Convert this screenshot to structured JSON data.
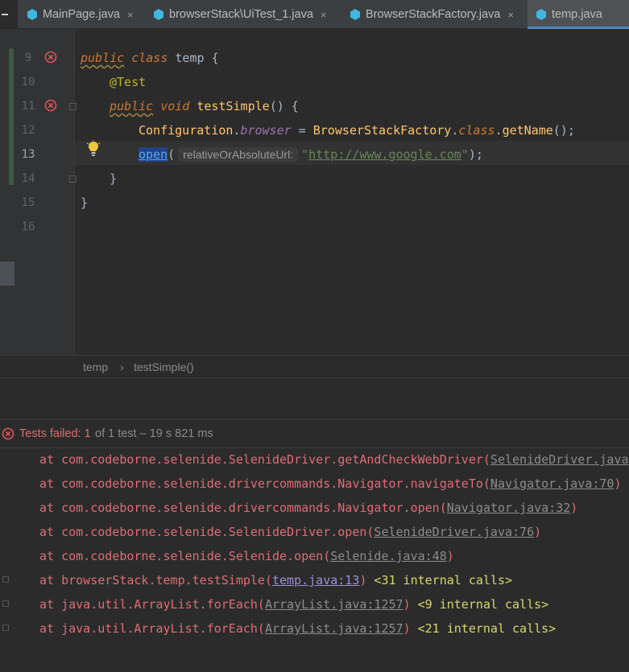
{
  "tabs": [
    {
      "label": "MainPage.java",
      "active": false
    },
    {
      "label": "browserStack\\UiTest_1.java",
      "active": false
    },
    {
      "label": "BrowserStackFactory.java",
      "active": false
    },
    {
      "label": "temp.java",
      "active": true
    }
  ],
  "tab_close": "×",
  "editor": {
    "line_numbers": [
      "9",
      "10",
      "11",
      "12",
      "13",
      "14",
      "15",
      "16"
    ],
    "line9": {
      "kw1": "public",
      "kw2": "class",
      "name": "temp",
      "brace": "{"
    },
    "line10": {
      "annotation": "@Test"
    },
    "line11": {
      "kw1": "public",
      "kw2": "void",
      "method": "testSimple",
      "rest": "() {"
    },
    "line12": {
      "cls": "Configuration",
      "dot": ".",
      "field": "browser",
      "eq": " = ",
      "factory": "BrowserStackFactory",
      "dot2": ".",
      "kwclass": "class",
      "dot3": ".",
      "getname": "getName",
      "end": "();"
    },
    "line13": {
      "call": "open",
      "paren": "(",
      "hint": "relativeOrAbsoluteUrl:",
      "q1": "\"",
      "url": "http://www.google.com",
      "q2": "\"",
      "end": ");"
    },
    "line14": {
      "brace": "}"
    },
    "line15": {
      "brace": "}"
    }
  },
  "breadcrumb": {
    "item1": "temp",
    "sep": "›",
    "item2": "testSimple()"
  },
  "status": {
    "failed_label": "Tests failed:",
    "failed_count": "1",
    "rest": "of 1 test – 19 s 821 ms"
  },
  "trace": [
    {
      "prefix": "at com.codeborne.selenide.SelenideDriver.getAndCheckWebDriver(",
      "link": "SelenideDriver.java",
      "suffix": "",
      "internal": ""
    },
    {
      "prefix": "at com.codeborne.selenide.drivercommands.Navigator.navigateTo(",
      "link": "Navigator.java:70",
      "suffix": ")",
      "internal": ""
    },
    {
      "prefix": "at com.codeborne.selenide.drivercommands.Navigator.open(",
      "link": "Navigator.java:32",
      "suffix": ")",
      "internal": ""
    },
    {
      "prefix": "at com.codeborne.selenide.SelenideDriver.open(",
      "link": "SelenideDriver.java:76",
      "suffix": ")",
      "internal": ""
    },
    {
      "prefix": "at com.codeborne.selenide.Selenide.open(",
      "link": "Selenide.java:48",
      "suffix": ")",
      "internal": ""
    },
    {
      "prefix": "at browserStack.temp.testSimple(",
      "link": "temp.java:13",
      "suffix": ")",
      "internal": " <31 internal calls>"
    },
    {
      "prefix": "at java.util.ArrayList.forEach(",
      "link": "ArrayList.java:1257",
      "suffix": ")",
      "internal": " <9 internal calls>"
    },
    {
      "prefix": "at java.util.ArrayList.forEach(",
      "link": "ArrayList.java:1257",
      "suffix": ")",
      "internal": " <21 internal calls>"
    }
  ],
  "colors": {
    "error": "#e06c75",
    "accent": "#4a88c7",
    "keyword": "#cc7832"
  }
}
